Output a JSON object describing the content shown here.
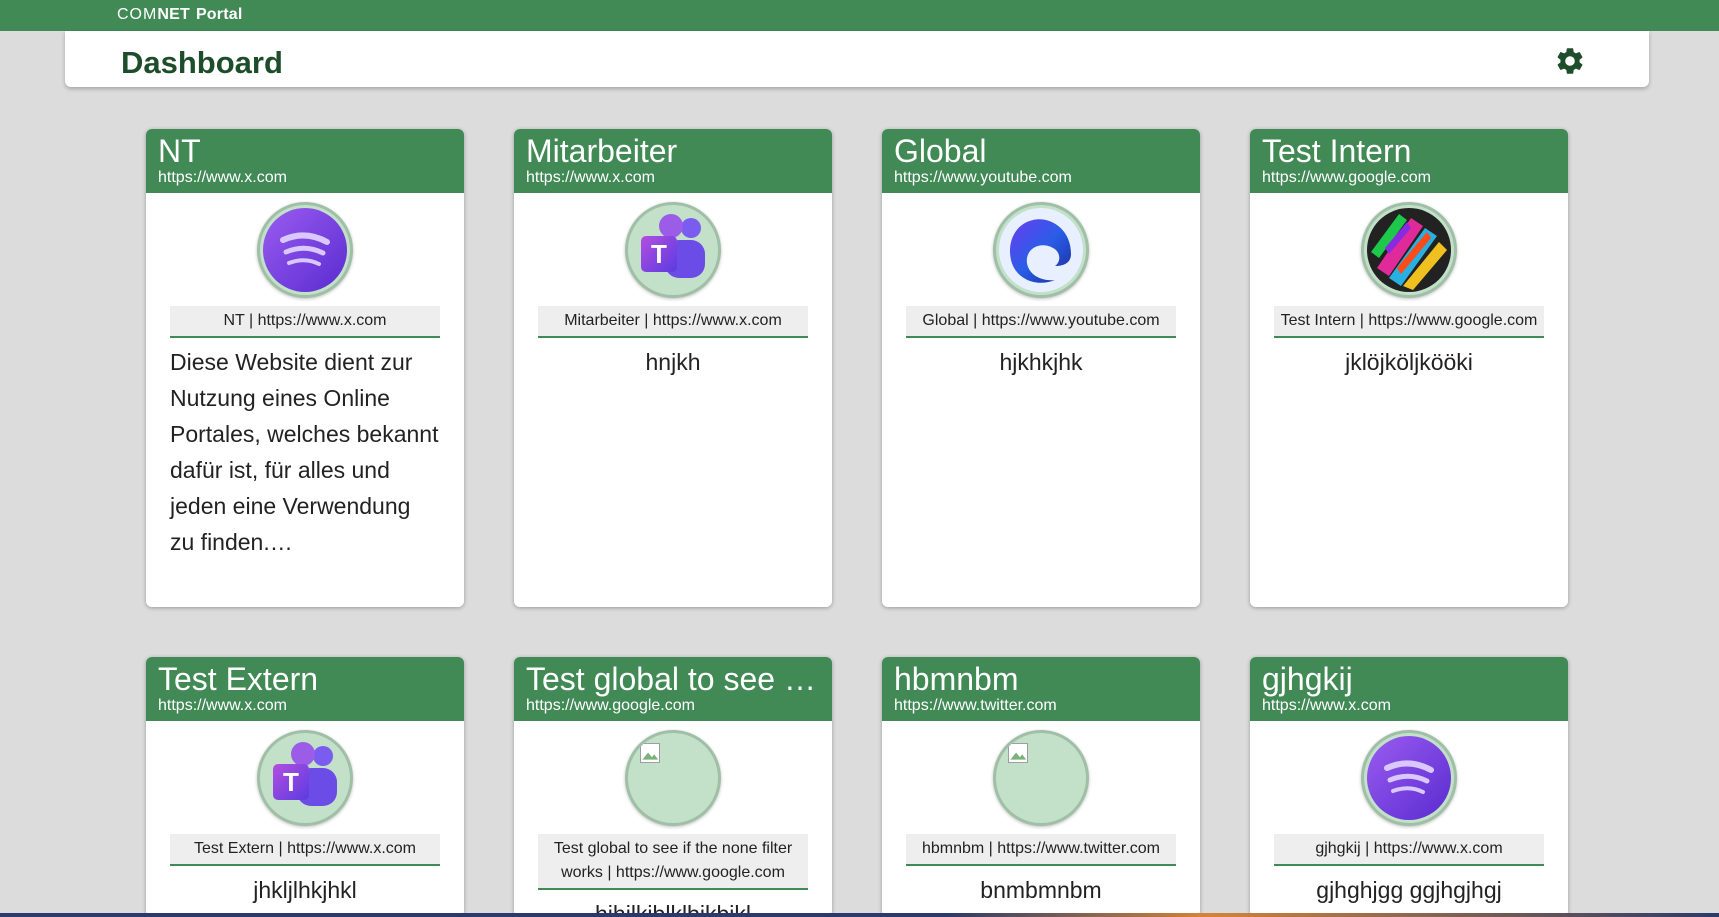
{
  "brand": {
    "com": "COM",
    "net": "NET",
    "portal": "Portal"
  },
  "header": {
    "title": "Dashboard",
    "settings_icon": "gear-icon"
  },
  "colors": {
    "green": "#418a56",
    "dark_green": "#1e4d2b",
    "background": "#dcdcdc"
  },
  "cards": [
    {
      "title": "NT",
      "url": "https://www.x.com",
      "icon": "spotify-icon",
      "info": "NT | https://www.x.com",
      "description": "Diese Website dient zur Nutzung eines Online Portales, welches bekannt dafür ist, für alles und jeden eine Verwendung zu finden.…"
    },
    {
      "title": "Mitarbeiter",
      "url": "https://www.x.com",
      "icon": "teams-icon",
      "info": "Mitarbeiter | https://www.x.com",
      "description": "hnjkh"
    },
    {
      "title": "Global",
      "url": "https://www.youtube.com",
      "icon": "edge-icon",
      "info": "Global | https://www.youtube.com",
      "description": "hjkhkjhk"
    },
    {
      "title": "Test Intern",
      "url": "https://www.google.com",
      "icon": "colorful-pattern-icon",
      "info": "Test Intern | https://www.google.com",
      "description": "jklöjköljkööki"
    },
    {
      "title": "Test Extern",
      "url": "https://www.x.com",
      "icon": "teams-icon",
      "info": "Test Extern | https://www.x.com",
      "description": "jhkljlhkjhkl"
    },
    {
      "title": "Test global to see …",
      "url": "https://www.google.com",
      "icon": "broken-image-icon",
      "info": "Test global to see if the none filter works | https://www.google.com",
      "description": "hihilkiblklbikbikl"
    },
    {
      "title": "hbmnbm",
      "url": "https://www.twitter.com",
      "icon": "broken-image-icon",
      "info": "hbmnbm | https://www.twitter.com",
      "description": "bnmbmnbm"
    },
    {
      "title": "gjhgkij",
      "url": "https://www.x.com",
      "icon": "spotify-icon",
      "info": "gjhgkij | https://www.x.com",
      "description": "gjhghjgg ggjhgjhgj"
    }
  ]
}
